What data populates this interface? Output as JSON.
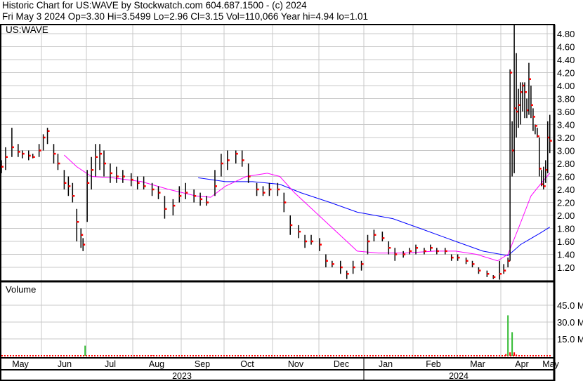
{
  "header": {
    "title": "Historic Chart for US:WAVE by Stockwatch.com 604.687.1500 - (c) 2024",
    "quote": "Fri May  3 2024  Op=3.30  Hi=3.5499  Lo=2.96  Cl=3.15  Vol=110,066  Year hi=4.94  lo=1.01"
  },
  "chart_data": {
    "type": "ohlc",
    "symbol": "US:WAVE",
    "volume_label": "Volume",
    "price_ticks": [
      "1.20",
      "1.40",
      "1.60",
      "1.80",
      "2.00",
      "2.20",
      "2.40",
      "2.60",
      "2.80",
      "3.00",
      "3.20",
      "3.40",
      "3.60",
      "3.80",
      "4.00",
      "4.20",
      "4.40",
      "4.60",
      "4.80"
    ],
    "price_range": [
      1.0,
      4.94
    ],
    "volume_ticks": [
      "15.0 M",
      "30.0 M",
      "45.0 M"
    ],
    "months": [
      "May",
      "Jun",
      "Jul",
      "Aug",
      "Sep",
      "Oct",
      "Nov",
      "Dec",
      "Jan",
      "Feb",
      "Mar",
      "Apr",
      "May"
    ],
    "years": [
      "2023",
      "2024"
    ],
    "bars_note": "trading-day index, high, low, close",
    "bars": [
      [
        0,
        2.85,
        2.65,
        2.75
      ],
      [
        2,
        3.05,
        2.7,
        2.9
      ],
      [
        5,
        3.35,
        2.9,
        3.05
      ],
      [
        8,
        3.1,
        2.9,
        2.98
      ],
      [
        10,
        3.0,
        2.88,
        2.95
      ],
      [
        13,
        3.0,
        2.85,
        2.92
      ],
      [
        15,
        2.95,
        2.88,
        2.9
      ],
      [
        18,
        3.1,
        2.9,
        3.0
      ],
      [
        20,
        3.25,
        3.0,
        3.2
      ],
      [
        22,
        3.35,
        3.1,
        3.3
      ],
      [
        25,
        3.1,
        2.8,
        2.95
      ],
      [
        27,
        2.95,
        2.7,
        2.8
      ],
      [
        30,
        2.7,
        2.4,
        2.5
      ],
      [
        32,
        2.6,
        2.3,
        2.45
      ],
      [
        34,
        2.5,
        2.2,
        2.3
      ],
      [
        36,
        2.1,
        1.6,
        1.9
      ],
      [
        38,
        1.8,
        1.5,
        1.7
      ],
      [
        39,
        1.65,
        1.45,
        1.55
      ],
      [
        41,
        2.7,
        1.9,
        2.5
      ],
      [
        43,
        2.9,
        2.4,
        2.7
      ],
      [
        45,
        3.1,
        2.6,
        2.9
      ],
      [
        47,
        3.1,
        2.7,
        2.95
      ],
      [
        49,
        3.0,
        2.6,
        2.8
      ],
      [
        52,
        2.8,
        2.5,
        2.65
      ],
      [
        55,
        2.75,
        2.5,
        2.6
      ],
      [
        58,
        2.7,
        2.5,
        2.6
      ],
      [
        62,
        2.65,
        2.45,
        2.55
      ],
      [
        65,
        2.6,
        2.4,
        2.5
      ],
      [
        68,
        2.6,
        2.4,
        2.45
      ],
      [
        72,
        2.5,
        2.3,
        2.4
      ],
      [
        75,
        2.45,
        2.25,
        2.35
      ],
      [
        78,
        2.3,
        1.95,
        2.1
      ],
      [
        82,
        2.25,
        2.0,
        2.15
      ],
      [
        85,
        2.45,
        2.2,
        2.3
      ],
      [
        88,
        2.5,
        2.25,
        2.35
      ],
      [
        92,
        2.4,
        2.2,
        2.3
      ],
      [
        95,
        2.35,
        2.15,
        2.25
      ],
      [
        98,
        2.3,
        2.15,
        2.2
      ],
      [
        102,
        2.7,
        2.3,
        2.45
      ],
      [
        105,
        2.95,
        2.6,
        2.8
      ],
      [
        108,
        3.0,
        2.7,
        2.85
      ],
      [
        112,
        3.0,
        2.8,
        2.95
      ],
      [
        115,
        3.0,
        2.75,
        2.85
      ],
      [
        118,
        2.8,
        2.5,
        2.6
      ],
      [
        122,
        2.5,
        2.3,
        2.4
      ],
      [
        125,
        2.45,
        2.3,
        2.35
      ],
      [
        128,
        2.5,
        2.3,
        2.4
      ],
      [
        132,
        2.5,
        2.3,
        2.4
      ],
      [
        135,
        2.35,
        2.05,
        2.2
      ],
      [
        138,
        2.0,
        1.7,
        1.85
      ],
      [
        142,
        1.85,
        1.65,
        1.75
      ],
      [
        145,
        1.7,
        1.5,
        1.6
      ],
      [
        148,
        1.7,
        1.55,
        1.6
      ],
      [
        152,
        1.65,
        1.45,
        1.55
      ],
      [
        155,
        1.4,
        1.2,
        1.3
      ],
      [
        158,
        1.3,
        1.2,
        1.25
      ],
      [
        162,
        1.3,
        1.1,
        1.2
      ],
      [
        165,
        1.15,
        1.02,
        1.1
      ],
      [
        168,
        1.3,
        1.1,
        1.2
      ],
      [
        172,
        1.3,
        1.15,
        1.25
      ],
      [
        175,
        1.7,
        1.4,
        1.6
      ],
      [
        178,
        1.78,
        1.6,
        1.7
      ],
      [
        182,
        1.75,
        1.6,
        1.65
      ],
      [
        185,
        1.6,
        1.4,
        1.5
      ],
      [
        188,
        1.5,
        1.3,
        1.4
      ],
      [
        192,
        1.45,
        1.35,
        1.4
      ],
      [
        195,
        1.5,
        1.4,
        1.45
      ],
      [
        198,
        1.55,
        1.4,
        1.5
      ],
      [
        202,
        1.5,
        1.4,
        1.45
      ],
      [
        205,
        1.55,
        1.45,
        1.5
      ],
      [
        208,
        1.5,
        1.4,
        1.45
      ],
      [
        212,
        1.5,
        1.4,
        1.45
      ],
      [
        215,
        1.4,
        1.3,
        1.35
      ],
      [
        218,
        1.4,
        1.3,
        1.35
      ],
      [
        222,
        1.35,
        1.25,
        1.3
      ],
      [
        225,
        1.3,
        1.2,
        1.25
      ],
      [
        228,
        1.2,
        1.1,
        1.15
      ],
      [
        232,
        1.15,
        1.05,
        1.1
      ],
      [
        235,
        1.08,
        1.02,
        1.05
      ],
      [
        238,
        1.3,
        1.01,
        1.1
      ],
      [
        240,
        1.25,
        1.1,
        1.15
      ],
      [
        242,
        1.35,
        1.2,
        1.3
      ],
      [
        243,
        4.25,
        1.3,
        4.2
      ],
      [
        244,
        3.45,
        2.6,
        3.0
      ],
      [
        245,
        4.94,
        2.65,
        3.65
      ],
      [
        246,
        4.5,
        3.2,
        3.6
      ],
      [
        247,
        3.95,
        3.35,
        3.7
      ],
      [
        248,
        4.05,
        3.4,
        3.9
      ],
      [
        249,
        4.05,
        3.6,
        4.0
      ],
      [
        250,
        4.05,
        3.5,
        3.9
      ],
      [
        251,
        3.8,
        3.5,
        3.62
      ],
      [
        252,
        4.35,
        3.55,
        4.1
      ],
      [
        253,
        4.0,
        3.5,
        3.7
      ],
      [
        254,
        3.65,
        3.3,
        3.52
      ],
      [
        255,
        3.4,
        3.25,
        3.38
      ],
      [
        256,
        3.35,
        3.2,
        3.22
      ],
      [
        257,
        3.2,
        2.6,
        2.72
      ],
      [
        258,
        2.7,
        2.45,
        2.48
      ],
      [
        259,
        2.75,
        2.4,
        2.45
      ],
      [
        260,
        2.85,
        2.5,
        2.7
      ],
      [
        261,
        3.45,
        2.65,
        3.2
      ],
      [
        262,
        3.55,
        2.96,
        3.15
      ]
    ],
    "ma_pink": [
      [
        30,
        2.93
      ],
      [
        36,
        2.75
      ],
      [
        43,
        2.6
      ],
      [
        53,
        2.58
      ],
      [
        67,
        2.52
      ],
      [
        80,
        2.4
      ],
      [
        93,
        2.3
      ],
      [
        100,
        2.28
      ],
      [
        107,
        2.45
      ],
      [
        117,
        2.6
      ],
      [
        127,
        2.65
      ],
      [
        133,
        2.6
      ],
      [
        140,
        2.35
      ],
      [
        150,
        2.05
      ],
      [
        160,
        1.75
      ],
      [
        170,
        1.45
      ],
      [
        180,
        1.42
      ],
      [
        193,
        1.42
      ],
      [
        207,
        1.45
      ],
      [
        217,
        1.45
      ],
      [
        227,
        1.4
      ],
      [
        237,
        1.3
      ],
      [
        242,
        1.4
      ],
      [
        247,
        1.8
      ],
      [
        253,
        2.3
      ],
      [
        258,
        2.5
      ],
      [
        262,
        2.65
      ]
    ],
    "ma_blue": [
      [
        94,
        2.58
      ],
      [
        107,
        2.52
      ],
      [
        120,
        2.52
      ],
      [
        133,
        2.48
      ],
      [
        143,
        2.35
      ],
      [
        157,
        2.2
      ],
      [
        170,
        2.05
      ],
      [
        187,
        1.95
      ],
      [
        200,
        1.8
      ],
      [
        217,
        1.6
      ],
      [
        230,
        1.45
      ],
      [
        242,
        1.38
      ],
      [
        248,
        1.55
      ],
      [
        257,
        1.72
      ],
      [
        262,
        1.82
      ]
    ],
    "volume_M": [
      [
        40,
        9
      ],
      [
        72,
        0.5
      ],
      [
        241,
        1.5
      ],
      [
        242,
        36
      ],
      [
        243,
        3
      ],
      [
        244,
        21
      ],
      [
        245,
        3
      ],
      [
        246,
        1
      ]
    ],
    "colors": {
      "bar": "#000000",
      "close_tick": "#ff0000",
      "ma_short": "#ff00ff",
      "ma_long": "#0000ff",
      "vol_up": "#33bb33",
      "vol_down": "#ff0000",
      "grid": "#c8c8c8"
    }
  }
}
